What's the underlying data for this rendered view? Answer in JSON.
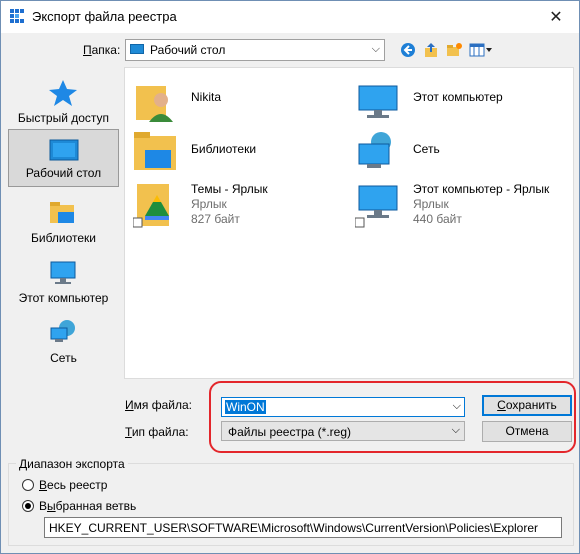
{
  "dialog": {
    "title": "Экспорт файла реестра"
  },
  "lookin": {
    "label_prefix": "",
    "label_hotkey": "П",
    "label_rest": "апка:",
    "value": "Рабочий стол"
  },
  "toolbar": {
    "icons": [
      "back-icon",
      "up-folder-icon",
      "new-folder-icon",
      "view-menu-icon"
    ]
  },
  "places": [
    {
      "label": "Быстрый доступ",
      "icon": "star-icon",
      "selected": false
    },
    {
      "label": "Рабочий стол",
      "icon": "desktop-icon",
      "selected": true
    },
    {
      "label": "Библиотеки",
      "icon": "libraries-icon",
      "selected": false
    },
    {
      "label": "Этот компьютер",
      "icon": "computer-icon",
      "selected": false
    },
    {
      "label": "Сеть",
      "icon": "network-icon",
      "selected": false
    }
  ],
  "files": [
    {
      "name": "Nikita",
      "icon": "user-folder-icon"
    },
    {
      "name": "Этот компьютер",
      "icon": "computer-icon"
    },
    {
      "name": "Библиотеки",
      "icon": "libraries-icon"
    },
    {
      "name": "Сеть",
      "icon": "network-icon"
    },
    {
      "name": "Темы - Ярлык",
      "type": "Ярлык",
      "size": "827 байт",
      "icon": "google-drive-shortcut-icon"
    },
    {
      "name": "Этот компьютер - Ярлык",
      "type": "Ярлык",
      "size": "440 байт",
      "icon": "computer-shortcut-icon"
    }
  ],
  "filename": {
    "label_hotkey": "И",
    "label_rest": "мя файла:",
    "value": "WinON"
  },
  "filetype": {
    "label_hotkey": "Т",
    "label_rest": "ип файла:",
    "value": "Файлы реестра (*.reg)"
  },
  "buttons": {
    "save_hotkey": "С",
    "save_rest": "охранить",
    "cancel": "Отмена"
  },
  "export_range": {
    "title": "Диапазон экспорта",
    "all_hotkey": "В",
    "all_rest": "есь реестр",
    "branch_hotkey": "ы",
    "branch_prefix": "В",
    "branch_rest": "бранная ветвь",
    "selected": "branch",
    "branch_value": "HKEY_CURRENT_USER\\SOFTWARE\\Microsoft\\Windows\\CurrentVersion\\Policies\\Explorer"
  },
  "colors": {
    "accent": "#0078d7",
    "highlight_box": "#e3262b",
    "folder": "#f2c14e"
  }
}
